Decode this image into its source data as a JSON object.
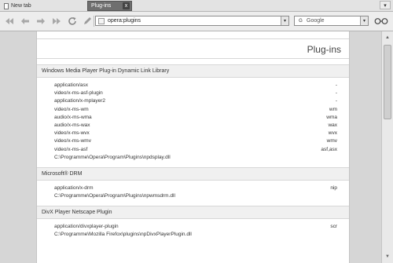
{
  "tabs": {
    "new_tab_label": "New tab",
    "active_tab_label": "Plug-ins",
    "close_glyph": "x",
    "menu_glyph": "▾"
  },
  "toolbar": {
    "address": "opera:plugins",
    "search_engine": "G",
    "search_placeholder": "Google",
    "dropdown_glyph": "▾",
    "zoom_glyph": "👓"
  },
  "page": {
    "title": "Plug-ins",
    "sections": [
      {
        "title": "Windows Media Player Plug-in Dynamic Link Library",
        "rows": [
          {
            "mime": "application/asx",
            "ext": "-"
          },
          {
            "mime": "video/x-ms-asf-plugin",
            "ext": "-"
          },
          {
            "mime": "application/x-mplayer2",
            "ext": "-"
          },
          {
            "mime": "video/x-ms-wm",
            "ext": "wm"
          },
          {
            "mime": "audio/x-ms-wma",
            "ext": "wma"
          },
          {
            "mime": "audio/x-ms-wax",
            "ext": "wax"
          },
          {
            "mime": "video/x-ms-wvx",
            "ext": "wvx"
          },
          {
            "mime": "video/x-ms-wmv",
            "ext": "wmv"
          },
          {
            "mime": "video/x-ms-asf",
            "ext": "asf,asx"
          }
        ],
        "path": "C:\\Programme\\Opera\\Program\\Plugins\\npdsplay.dll"
      },
      {
        "title": "Microsoft® DRM",
        "rows": [
          {
            "mime": "application/x-drm",
            "ext": "nip"
          }
        ],
        "path": "C:\\Programme\\Opera\\Program\\Plugins\\npwmsdrm.dll"
      },
      {
        "title": "DivX Player Netscape Plugin",
        "rows": [
          {
            "mime": "application/divxplayer-plugin",
            "ext": "scr"
          }
        ],
        "path": "C:\\Programme\\Mozilla Firefox\\plugins\\npDivxPlayerPlugin.dll"
      }
    ]
  },
  "icons": {
    "rewind": "rewind-icon",
    "back": "back-icon",
    "forward": "forward-icon",
    "fast_forward": "fast-forward-icon",
    "reload": "reload-icon",
    "edit": "edit-icon",
    "page": "page-icon",
    "zoom": "glasses-icon"
  }
}
